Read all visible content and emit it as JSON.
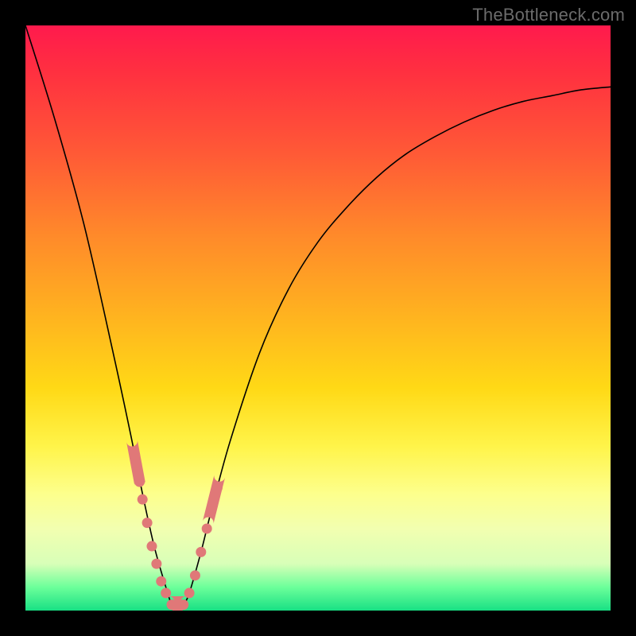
{
  "watermark": "TheBottleneck.com",
  "colors": {
    "frame": "#000000",
    "curve": "#000000",
    "marker": "#e07878",
    "gradient_top": "#ff1a4d",
    "gradient_bottom": "#18e084"
  },
  "chart_data": {
    "type": "line",
    "title": "",
    "xlabel": "",
    "ylabel": "",
    "xlim": [
      0,
      100
    ],
    "ylim": [
      0,
      100
    ],
    "x": [
      0,
      5,
      10,
      15,
      18,
      20,
      22,
      24,
      25,
      26,
      27,
      28,
      30,
      32,
      35,
      40,
      45,
      50,
      55,
      60,
      65,
      70,
      75,
      80,
      85,
      90,
      95,
      100
    ],
    "values": [
      100,
      84,
      66,
      44,
      30,
      20,
      11,
      4,
      1,
      0,
      1,
      3,
      10,
      18,
      29,
      44,
      55,
      63,
      69,
      74,
      78,
      81,
      83.5,
      85.5,
      87,
      88,
      89,
      89.5
    ],
    "series": [
      {
        "name": "bottleneck-curve",
        "x": [
          0,
          5,
          10,
          15,
          18,
          20,
          22,
          24,
          25,
          26,
          27,
          28,
          30,
          32,
          35,
          40,
          45,
          50,
          55,
          60,
          65,
          70,
          75,
          80,
          85,
          90,
          95,
          100
        ],
        "y": [
          100,
          84,
          66,
          44,
          30,
          20,
          11,
          4,
          1,
          0,
          1,
          3,
          10,
          18,
          29,
          44,
          55,
          63,
          69,
          74,
          78,
          81,
          83.5,
          85.5,
          87,
          88,
          89,
          89.5
        ]
      }
    ],
    "markers": [
      {
        "x": 19.0,
        "y": 25
      },
      {
        "x": 19.5,
        "y": 22
      },
      {
        "x": 20.0,
        "y": 19
      },
      {
        "x": 20.8,
        "y": 15
      },
      {
        "x": 21.6,
        "y": 11
      },
      {
        "x": 22.4,
        "y": 8
      },
      {
        "x": 23.2,
        "y": 5
      },
      {
        "x": 24.0,
        "y": 3
      },
      {
        "x": 25.0,
        "y": 1
      },
      {
        "x": 26.0,
        "y": 0
      },
      {
        "x": 27.0,
        "y": 1
      },
      {
        "x": 28.0,
        "y": 3
      },
      {
        "x": 29.0,
        "y": 6
      },
      {
        "x": 30.0,
        "y": 10
      },
      {
        "x": 31.0,
        "y": 14
      },
      {
        "x": 32.0,
        "y": 18
      },
      {
        "x": 32.8,
        "y": 21
      }
    ],
    "minimum": {
      "x": 26,
      "y": 0
    }
  }
}
